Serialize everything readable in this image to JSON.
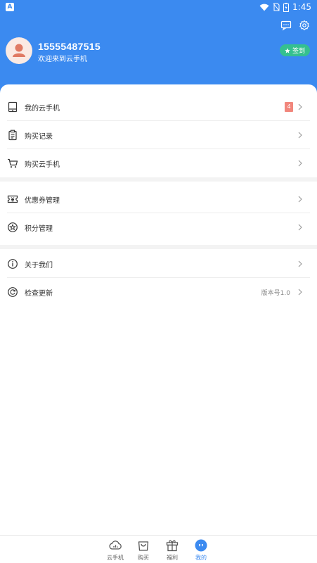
{
  "status_bar": {
    "time": "1:45",
    "left_glyph": "A"
  },
  "header": {
    "phone": "15555487515",
    "welcome": "欢迎来到云手机",
    "signin_label": "签到"
  },
  "menu": {
    "group1": [
      {
        "label": "我的云手机",
        "icon": "tablet-icon",
        "badge": "4"
      },
      {
        "label": "购买记录",
        "icon": "clipboard-icon"
      },
      {
        "label": "购买云手机",
        "icon": "cart-icon"
      }
    ],
    "group2": [
      {
        "label": "优惠券管理",
        "icon": "ticket-icon"
      },
      {
        "label": "积分管理",
        "icon": "points-icon"
      }
    ],
    "group3": [
      {
        "label": "关于我们",
        "icon": "info-icon"
      },
      {
        "label": "检查更新",
        "icon": "refresh-icon",
        "value": "版本号1.0"
      }
    ]
  },
  "tabbar": {
    "tabs": [
      {
        "label": "云手机"
      },
      {
        "label": "购买"
      },
      {
        "label": "福利"
      },
      {
        "label": "我的"
      }
    ],
    "active_index": 3
  },
  "colors": {
    "primary": "#3b8af0",
    "signin": "#35c08f",
    "badge": "#f1867c"
  }
}
